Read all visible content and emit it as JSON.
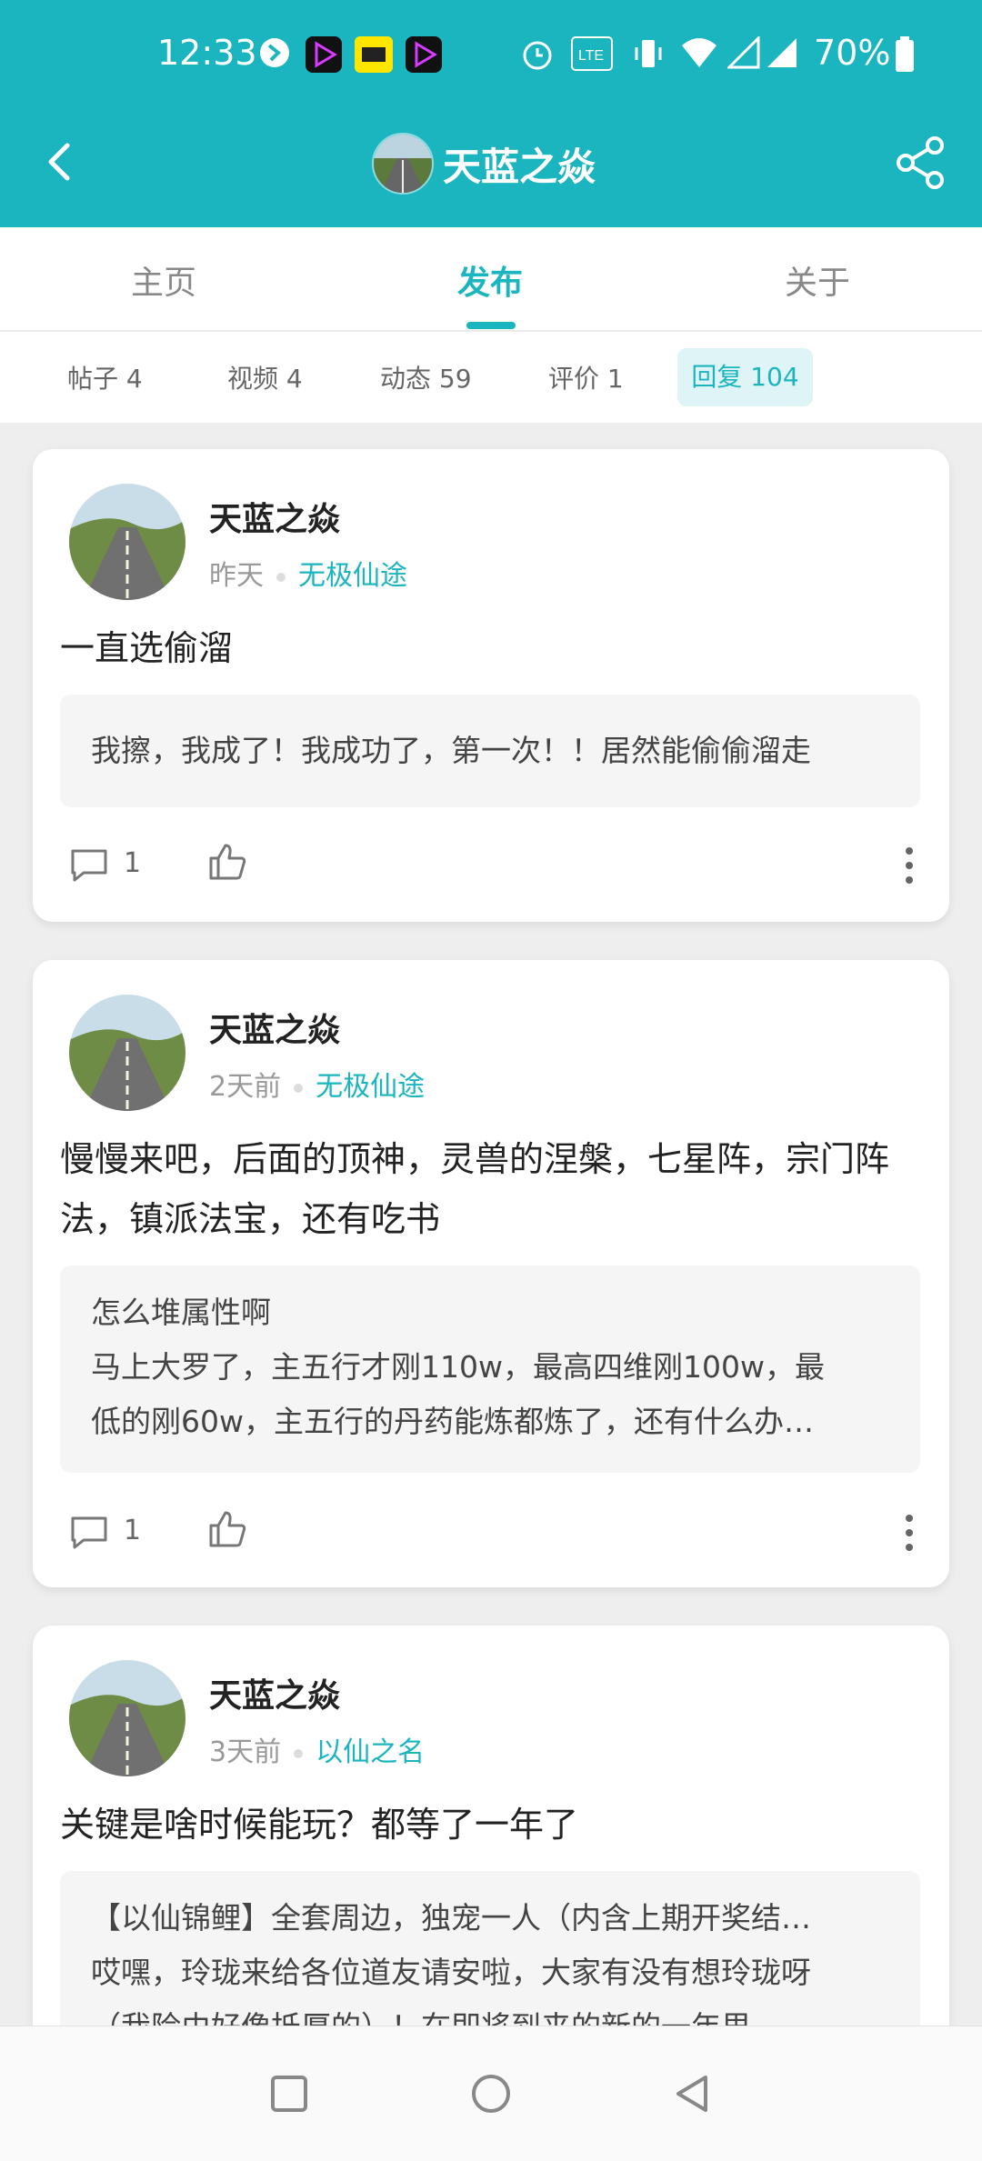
{
  "status_bar": {
    "time": "12:33",
    "battery": "70%"
  },
  "header": {
    "title": "天蓝之焱"
  },
  "tabs": [
    {
      "label": "主页"
    },
    {
      "label": "发布"
    },
    {
      "label": "关于"
    }
  ],
  "subtabs": [
    {
      "label": "帖子 4"
    },
    {
      "label": "视频 4"
    },
    {
      "label": "动态 59"
    },
    {
      "label": "评价 1"
    },
    {
      "label": "回复 104"
    }
  ],
  "posts": [
    {
      "user": "天蓝之焱",
      "time": "昨天",
      "game": "无极仙途",
      "content": "一直选偷溜",
      "quote": [
        "我擦，我成了！我成功了，第一次！！居然能偷偷溜走"
      ],
      "comments": "1"
    },
    {
      "user": "天蓝之焱",
      "time": "2天前",
      "game": "无极仙途",
      "content": "慢慢来吧，后面的顶神，灵兽的涅槃，七星阵，宗门阵法，镇派法宝，还有吃书",
      "quote": [
        "怎么堆属性啊",
        "马上大罗了，主五行才刚110w，最高四维刚100w，最",
        "低的刚60w，主五行的丹药能炼都炼了，还有什么办…"
      ],
      "comments": "1"
    },
    {
      "user": "天蓝之焱",
      "time": "3天前",
      "game": "以仙之名",
      "content": "关键是啥时候能玩？都等了一年了",
      "quote": [
        "【以仙锦鲤】全套周边，独宠一人（内含上期开奖结…",
        "哎嘿，玲珑来给各位道友请安啦，大家有没有想玲珑呀",
        "（我险由好像抵厚的）！在即将到来的新的一年里"
      ],
      "comments": ""
    }
  ]
}
